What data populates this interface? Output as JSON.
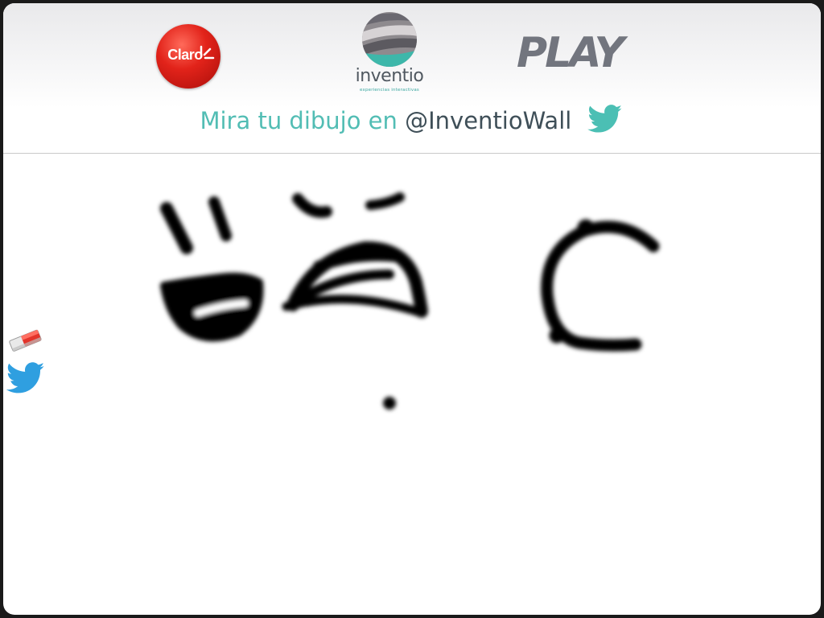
{
  "header": {
    "logos": {
      "claro": "Claro",
      "inventio": "inventio",
      "inventio_tagline": "experiencias interactivas",
      "play": "PLAY"
    },
    "twitter_prompt": {
      "prefix": "Mira tu dibujo en ",
      "handle": "@InventioWall"
    }
  },
  "toolbar": {
    "tools": [
      {
        "icon": "eraser-icon"
      },
      {
        "icon": "twitter-icon"
      }
    ]
  },
  "colors": {
    "claro_red": "#e2231a",
    "inventio_teal": "#52bdb4",
    "handle_dark": "#3f4f58",
    "play_gray": "#72757e",
    "twitter_blue": "#55acee",
    "ink": "#000000"
  }
}
